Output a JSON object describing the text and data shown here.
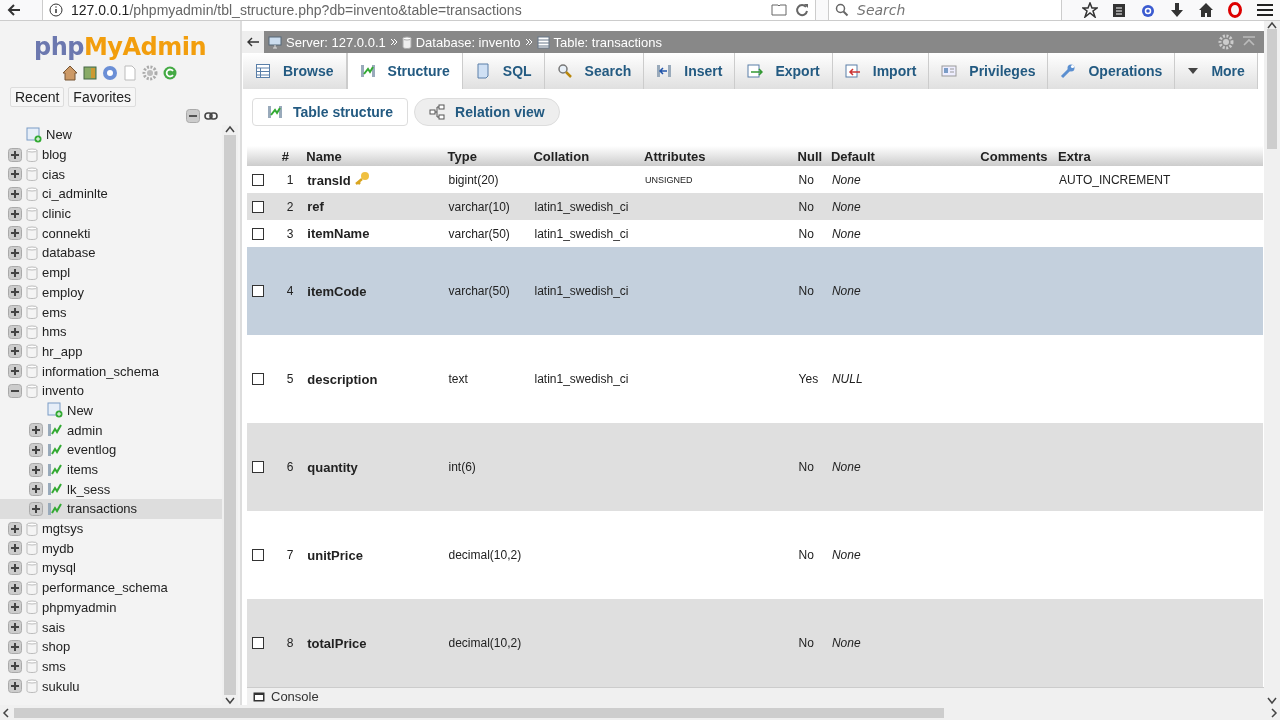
{
  "browser": {
    "url_host": "127.0.0.1",
    "url_path": "/phpmyadmin/tbl_structure.php?db=invento&table=transactions",
    "search_placeholder": "Search"
  },
  "sidebar": {
    "logo_php": "php",
    "logo_name": "MyAdmin",
    "tabs": [
      {
        "label": "Recent"
      },
      {
        "label": "Favorites"
      }
    ],
    "tree": [
      {
        "label": "New",
        "kind": "new"
      },
      {
        "label": "blog",
        "kind": "database",
        "expanded": false
      },
      {
        "label": "cias",
        "kind": "database",
        "expanded": false
      },
      {
        "label": "ci_adminlte",
        "kind": "database",
        "expanded": false
      },
      {
        "label": "clinic",
        "kind": "database",
        "expanded": false
      },
      {
        "label": "connekti",
        "kind": "database",
        "expanded": false
      },
      {
        "label": "database",
        "kind": "database",
        "expanded": false
      },
      {
        "label": "empl",
        "kind": "database",
        "expanded": false
      },
      {
        "label": "employ",
        "kind": "database",
        "expanded": false
      },
      {
        "label": "ems",
        "kind": "database",
        "expanded": false
      },
      {
        "label": "hms",
        "kind": "database",
        "expanded": false
      },
      {
        "label": "hr_app",
        "kind": "database",
        "expanded": false
      },
      {
        "label": "information_schema",
        "kind": "database",
        "expanded": false
      },
      {
        "label": "invento",
        "kind": "database",
        "expanded": true,
        "children": [
          {
            "label": "New",
            "kind": "new"
          },
          {
            "label": "admin",
            "kind": "table",
            "selected": false
          },
          {
            "label": "eventlog",
            "kind": "table",
            "selected": false
          },
          {
            "label": "items",
            "kind": "table",
            "selected": false
          },
          {
            "label": "lk_sess",
            "kind": "table",
            "selected": false
          },
          {
            "label": "transactions",
            "kind": "table",
            "selected": true
          }
        ]
      },
      {
        "label": "mgtsys",
        "kind": "database",
        "expanded": false
      },
      {
        "label": "mydb",
        "kind": "database",
        "expanded": false
      },
      {
        "label": "mysql",
        "kind": "database",
        "expanded": false
      },
      {
        "label": "performance_schema",
        "kind": "database",
        "expanded": false
      },
      {
        "label": "phpmyadmin",
        "kind": "database",
        "expanded": false
      },
      {
        "label": "sais",
        "kind": "database",
        "expanded": false
      },
      {
        "label": "shop",
        "kind": "database",
        "expanded": false
      },
      {
        "label": "sms",
        "kind": "database",
        "expanded": false
      },
      {
        "label": "sukulu",
        "kind": "database",
        "expanded": false
      }
    ]
  },
  "breadcrumb": [
    {
      "kind": "server",
      "text": "Server: 127.0.0.1"
    },
    {
      "kind": "database",
      "text": "Database: invento"
    },
    {
      "kind": "table",
      "text": "Table: transactions"
    }
  ],
  "tabs": [
    {
      "label": "Browse",
      "selected": false
    },
    {
      "label": "Structure",
      "selected": true
    },
    {
      "label": "SQL",
      "selected": false
    },
    {
      "label": "Search",
      "selected": false
    },
    {
      "label": "Insert",
      "selected": false
    },
    {
      "label": "Export",
      "selected": false
    },
    {
      "label": "Import",
      "selected": false
    },
    {
      "label": "Privileges",
      "selected": false
    },
    {
      "label": "Operations",
      "selected": false
    },
    {
      "label": "More",
      "selected": false
    }
  ],
  "subtabs": [
    {
      "label": "Table structure",
      "selected": true
    },
    {
      "label": "Relation view",
      "selected": false
    }
  ],
  "table": {
    "columns": [
      "#",
      "Name",
      "Type",
      "Collation",
      "Attributes",
      "Null",
      "Default",
      "Comments",
      "Extra"
    ],
    "rows": [
      {
        "num": "1",
        "name": "transId",
        "primary_key": true,
        "type": "bigint(20)",
        "attributes": "UNSIGNED",
        "null": "No",
        "default": "None",
        "extra": "AUTO_INCREMENT",
        "checked": false,
        "highlighted": false
      },
      {
        "num": "2",
        "name": "ref",
        "primary_key": false,
        "type": "varchar(10)",
        "collation": "latin1_swedish_ci",
        "null": "No",
        "default": "None",
        "checked": false,
        "highlighted": false
      },
      {
        "num": "3",
        "name": "itemName",
        "primary_key": false,
        "type": "varchar(50)",
        "collation": "latin1_swedish_ci",
        "null": "No",
        "default": "None",
        "checked": false,
        "highlighted": false
      },
      {
        "num": "4",
        "name": "itemCode",
        "primary_key": false,
        "type": "varchar(50)",
        "collation": "latin1_swedish_ci",
        "null": "No",
        "default": "None",
        "checked": false,
        "highlighted": true
      },
      {
        "num": "5",
        "name": "description",
        "primary_key": false,
        "type": "text",
        "collation": "latin1_swedish_ci",
        "null": "Yes",
        "default": "NULL",
        "checked": false,
        "highlighted": false
      },
      {
        "num": "6",
        "name": "quantity",
        "primary_key": false,
        "type": "int(6)",
        "null": "No",
        "default": "None",
        "checked": false,
        "highlighted": false
      },
      {
        "num": "7",
        "name": "unitPrice",
        "primary_key": false,
        "type": "decimal(10,2)",
        "null": "No",
        "default": "None",
        "checked": false,
        "highlighted": false
      },
      {
        "num": "8",
        "name": "totalPrice",
        "primary_key": false,
        "type": "decimal(10,2)",
        "null": "No",
        "default": "None",
        "checked": false,
        "highlighted": false
      }
    ]
  },
  "console": {
    "label": "Console"
  }
}
